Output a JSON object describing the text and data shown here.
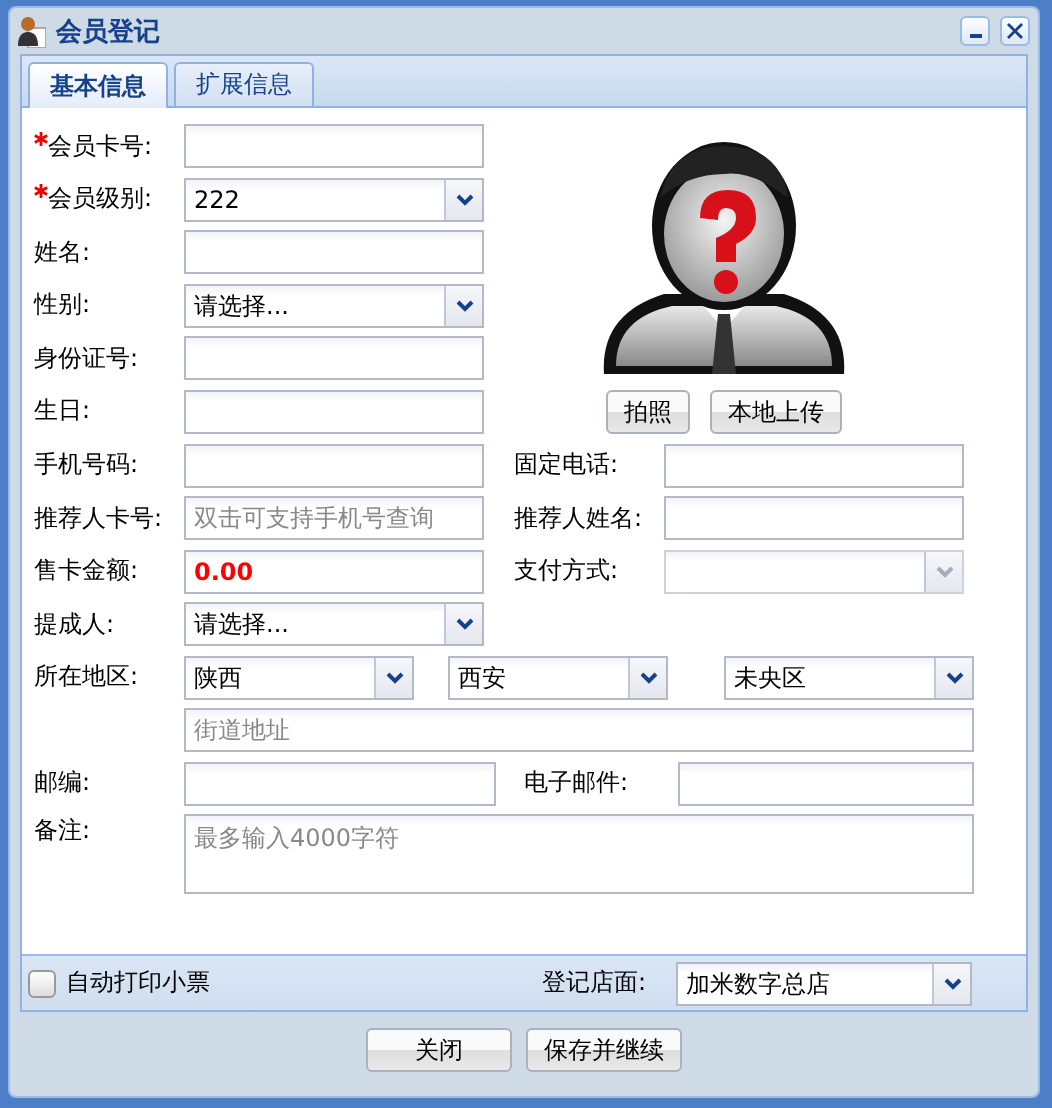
{
  "window": {
    "title": "会员登记"
  },
  "tabs": [
    {
      "label": "基本信息",
      "selected": true
    },
    {
      "label": "扩展信息",
      "selected": false
    }
  ],
  "profile_fields": [
    {
      "label": "会员卡号:",
      "required": true,
      "kind": "text"
    },
    {
      "label": "会员级别:",
      "required": true,
      "kind": "select",
      "value": "222"
    },
    {
      "label": "姓名:",
      "required": false,
      "kind": "text"
    },
    {
      "label": "性别:",
      "required": false,
      "kind": "select",
      "value": "请选择..."
    },
    {
      "label": "身份证号:",
      "required": false,
      "kind": "text"
    },
    {
      "label": "生日:",
      "required": false,
      "kind": "text"
    }
  ],
  "photo_buttons": [
    "拍照",
    "本地上传"
  ],
  "paired_rows": [
    {
      "left": {
        "label": "手机号码:",
        "kind": "text",
        "disabled": false
      },
      "right": {
        "label": "固定电话:",
        "kind": "text",
        "disabled": false
      }
    },
    {
      "left": {
        "label": "推荐人卡号:",
        "kind": "text",
        "placeholder": "双击可支持手机号查询",
        "disabled": false
      },
      "right": {
        "label": "推荐人姓名:",
        "kind": "text",
        "disabled": false
      }
    },
    {
      "left": {
        "label": "售卡金额:",
        "kind": "amount",
        "value": "0.00",
        "disabled": false
      },
      "right": {
        "label": "支付方式:",
        "kind": "select",
        "disabled": true
      }
    }
  ],
  "commission": {
    "label": "提成人:",
    "value": "请选择..."
  },
  "region": {
    "label": "所在地区:",
    "selects": [
      "陕西",
      "西安",
      "未央区"
    ],
    "street_placeholder": "街道地址"
  },
  "postcode": {
    "label": "邮编:"
  },
  "email": {
    "label": "电子邮件:"
  },
  "remarks": {
    "label": "备注:",
    "placeholder": "最多输入4000字符"
  },
  "footer": {
    "auto_print": {
      "label": "自动打印小票",
      "checked": false
    },
    "store": {
      "label": "登记店面:",
      "value": "加米数字总店"
    }
  },
  "buttons": [
    "关闭",
    "保存并继续"
  ]
}
